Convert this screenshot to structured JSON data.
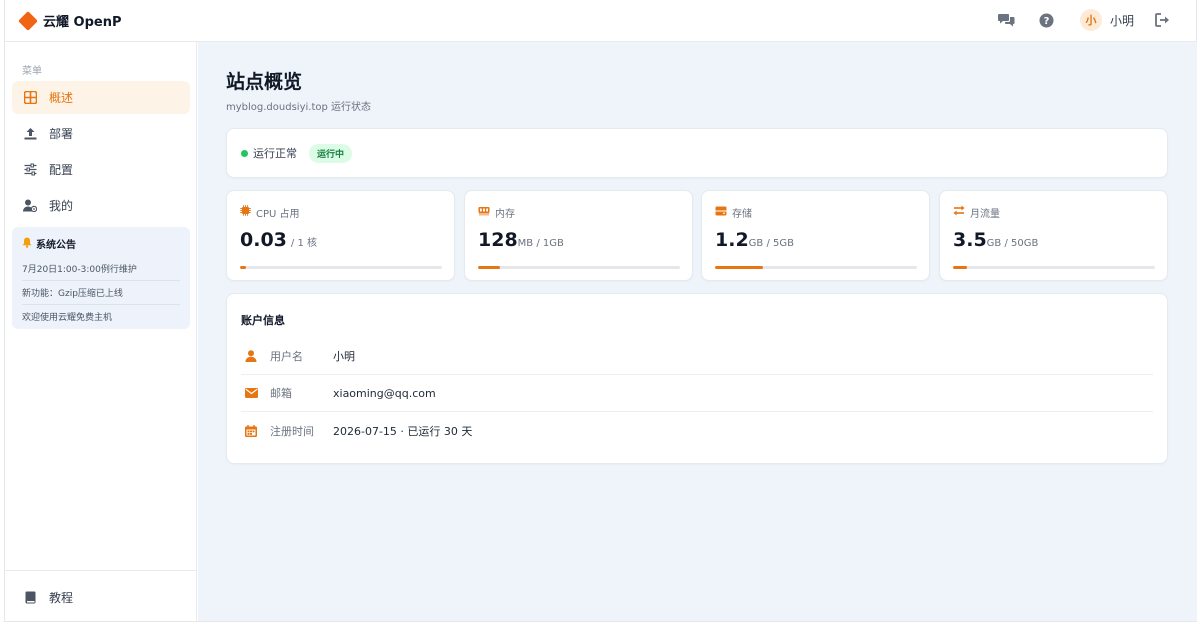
{
  "header": {
    "brand": "云耀 OpenP",
    "avatar_char": "小",
    "username": "小明"
  },
  "sidebar": {
    "menu_title": "菜单",
    "items": [
      {
        "label": "概述",
        "icon": "grid-icon",
        "active": true
      },
      {
        "label": "部署",
        "icon": "upload-icon",
        "active": false
      },
      {
        "label": "配置",
        "icon": "sliders-icon",
        "active": false
      },
      {
        "label": "我的",
        "icon": "user-gear-icon",
        "active": false
      }
    ],
    "notice": {
      "title": "系统公告",
      "items": [
        "7月20日1:00-3:00例行维护",
        "新功能：Gzip压缩已上线",
        "欢迎使用云耀免费主机"
      ]
    },
    "footer_item": {
      "label": "教程",
      "icon": "book-icon"
    }
  },
  "main": {
    "title": "站点概览",
    "subtitle": "myblog.doudsiyi.top 运行状态",
    "status": {
      "text": "运行正常",
      "badge": "运行中"
    },
    "stats": [
      {
        "label": "CPU 占用",
        "value": "0.03",
        "unit": "/ 1 核",
        "fraction": 0.03,
        "icon": "chip-icon"
      },
      {
        "label": "内存",
        "value": "128",
        "unit": "MB / 1GB",
        "fraction": 0.11,
        "icon": "memory-icon"
      },
      {
        "label": "存储",
        "value": "1.2",
        "unit": "GB / 5GB",
        "fraction": 0.24,
        "icon": "storage-icon"
      },
      {
        "label": "月流量",
        "value": "3.5",
        "unit": "GB / 50GB",
        "fraction": 0.07,
        "icon": "transfer-icon"
      }
    ],
    "account": {
      "title": "账户信息",
      "rows": [
        {
          "label": "用户名",
          "value": "小明",
          "icon": "user-icon"
        },
        {
          "label": "邮箱",
          "value": "xiaoming@qq.com",
          "icon": "mail-icon"
        },
        {
          "label": "注册时间",
          "value": "2026-07-15 · 已运行 30 天",
          "icon": "calendar-icon"
        }
      ]
    }
  },
  "colors": {
    "accent": "#e67512",
    "accent_bg": "#fdf3e7",
    "success": "#22c55e",
    "main_bg": "#eff4fa"
  }
}
